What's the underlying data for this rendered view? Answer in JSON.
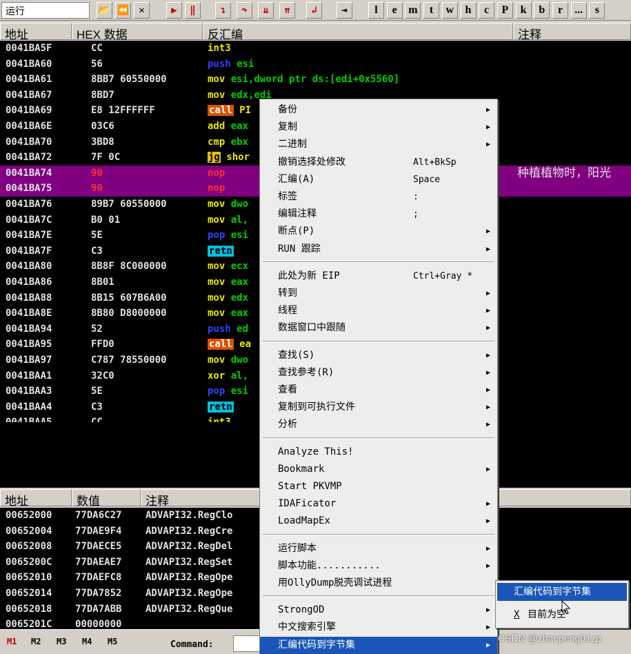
{
  "toolbar": {
    "status": "运行",
    "letters": [
      "l",
      "e",
      "m",
      "t",
      "w",
      "h",
      "c",
      "P",
      "k",
      "b",
      "r",
      "...",
      "s"
    ]
  },
  "cpu_headers": {
    "addr": "地址",
    "hex": "HEX 数据",
    "dis": "反汇编",
    "cmt": "注释"
  },
  "cpu_rows": [
    {
      "addr": "0041BA5F",
      "hex": "CC",
      "dis": "int3",
      "sel": false
    },
    {
      "addr": "0041BA60",
      "hex": "56",
      "dis": "push esi",
      "sel": false
    },
    {
      "addr": "0041BA61",
      "hex": "8BB7 60550000",
      "dis": "mov esi,dword ptr ds:[edi+0x5560]",
      "sel": false
    },
    {
      "addr": "0041BA67",
      "hex": "8BD7",
      "dis": "mov edx,edi",
      "sel": false
    },
    {
      "addr": "0041BA69",
      "hex": "E8 12FFFFFF",
      "dis": "call PI",
      "sel": false
    },
    {
      "addr": "0041BA6E",
      "hex": "03C6",
      "dis": "add eax",
      "sel": false
    },
    {
      "addr": "0041BA70",
      "hex": "3BD8",
      "dis": "cmp ebx",
      "sel": false
    },
    {
      "addr": "0041BA72",
      "hex": "7F 0C",
      "dis": "jg shor",
      "sel": false
    },
    {
      "addr": "0041BA74",
      "hex": "90",
      "dis": "nop",
      "sel": true,
      "cmt": "种植植物时，阳光"
    },
    {
      "addr": "0041BA75",
      "hex": "90",
      "dis": "nop",
      "sel": true
    },
    {
      "addr": "0041BA76",
      "hex": "89B7 60550000",
      "dis": "mov dwo",
      "sel": false
    },
    {
      "addr": "0041BA7C",
      "hex": "B0 01",
      "dis": "mov al,",
      "sel": false
    },
    {
      "addr": "0041BA7E",
      "hex": "5E",
      "dis": "pop esi",
      "sel": false
    },
    {
      "addr": "0041BA7F",
      "hex": "C3",
      "dis": "retn",
      "sel": false
    },
    {
      "addr": "0041BA80",
      "hex": "8B8F 8C000000",
      "dis": "mov ecx",
      "sel": false
    },
    {
      "addr": "0041BA86",
      "hex": "8B01",
      "dis": "mov eax",
      "sel": false
    },
    {
      "addr": "0041BA88",
      "hex": "8B15 607B6A00",
      "dis": "mov edx",
      "sel": false
    },
    {
      "addr": "0041BA8E",
      "hex": "8B80 D8000000",
      "dis": "mov eax",
      "sel": false
    },
    {
      "addr": "0041BA94",
      "hex": "52",
      "dis": "push ed",
      "sel": false
    },
    {
      "addr": "0041BA95",
      "hex": "FFD0",
      "dis": "call ea",
      "sel": false
    },
    {
      "addr": "0041BA97",
      "hex": "C787 78550000",
      "dis": "mov dwo",
      "sel": false
    },
    {
      "addr": "0041BAA1",
      "hex": "32C0",
      "dis": "xor al,",
      "sel": false
    },
    {
      "addr": "0041BAA3",
      "hex": "5E",
      "dis": "pop esi",
      "sel": false
    },
    {
      "addr": "0041BAA4",
      "hex": "C3",
      "dis": "retn",
      "sel": false
    },
    {
      "addr": "0041BAA5",
      "hex": "CC",
      "dis": "int3",
      "sel": false
    }
  ],
  "dump_headers": {
    "addr": "地址",
    "val": "数值",
    "cmt": "注释"
  },
  "dump_rows": [
    {
      "addr": "00652000",
      "val": "77DA6C27",
      "cmt": "ADVAPI32.RegClo"
    },
    {
      "addr": "00652004",
      "val": "77DAE9F4",
      "cmt": "ADVAPI32.RegCre"
    },
    {
      "addr": "00652008",
      "val": "77DAECE5",
      "cmt": "ADVAPI32.RegDel"
    },
    {
      "addr": "0065200C",
      "val": "77DAEAE7",
      "cmt": "ADVAPI32.RegSet"
    },
    {
      "addr": "00652010",
      "val": "77DAEFC8",
      "cmt": "ADVAPI32.RegOpe"
    },
    {
      "addr": "00652014",
      "val": "77DA7852",
      "cmt": "ADVAPI32.RegOpe"
    },
    {
      "addr": "00652018",
      "val": "77DA7ABB",
      "cmt": "ADVAPI32.RegQue"
    },
    {
      "addr": "0065201C",
      "val": "00000000",
      "cmt": ""
    }
  ],
  "statusbar": {
    "tabs": [
      "M1",
      "M2",
      "M3",
      "M4",
      "M5"
    ],
    "command_label": "Command:"
  },
  "context_menu": [
    {
      "label": "备份",
      "sub": true
    },
    {
      "label": "复制",
      "sub": true
    },
    {
      "label": "二进制",
      "sub": true
    },
    {
      "label": "撤销选择处修改",
      "shortcut": "Alt+BkSp"
    },
    {
      "label": "汇编(A)",
      "shortcut": "Space"
    },
    {
      "label": "标签",
      "shortcut": ":"
    },
    {
      "label": "编辑注释",
      "shortcut": ";"
    },
    {
      "label": "断点(P)",
      "sub": true
    },
    {
      "label": "RUN 跟踪",
      "sub": true
    },
    {
      "sep": true
    },
    {
      "label": "此处为新 EIP",
      "shortcut": "Ctrl+Gray *"
    },
    {
      "label": "转到",
      "sub": true
    },
    {
      "label": "线程",
      "sub": true
    },
    {
      "label": "数据窗口中跟随",
      "sub": true
    },
    {
      "sep": true
    },
    {
      "label": "查找(S)",
      "sub": true
    },
    {
      "label": "查找参考(R)",
      "sub": true
    },
    {
      "label": "查看",
      "sub": true
    },
    {
      "label": "复制到可执行文件",
      "sub": true
    },
    {
      "label": "分析",
      "sub": true
    },
    {
      "sep": true
    },
    {
      "label": "Analyze This!"
    },
    {
      "label": "Bookmark",
      "sub": true
    },
    {
      "label": "Start PKVMP"
    },
    {
      "label": "IDAFicator",
      "sub": true
    },
    {
      "label": "LoadMapEx",
      "sub": true
    },
    {
      "sep": true
    },
    {
      "label": "运行脚本",
      "sub": true
    },
    {
      "label": "脚本功能...........",
      "sub": true
    },
    {
      "label": "用OllyDump脱壳调试进程"
    },
    {
      "sep": true
    },
    {
      "label": "StrongOD",
      "sub": true
    },
    {
      "label": "中文搜索引擎",
      "sub": true
    },
    {
      "label": "汇编代码到字节集",
      "sub": true,
      "hl": true
    }
  ],
  "submenu": [
    {
      "label": "汇编代码到字节集",
      "hl": true
    },
    {
      "key": "X",
      "label": "目前为空"
    }
  ],
  "watermark": "CSDN @zhaopeng01zp"
}
